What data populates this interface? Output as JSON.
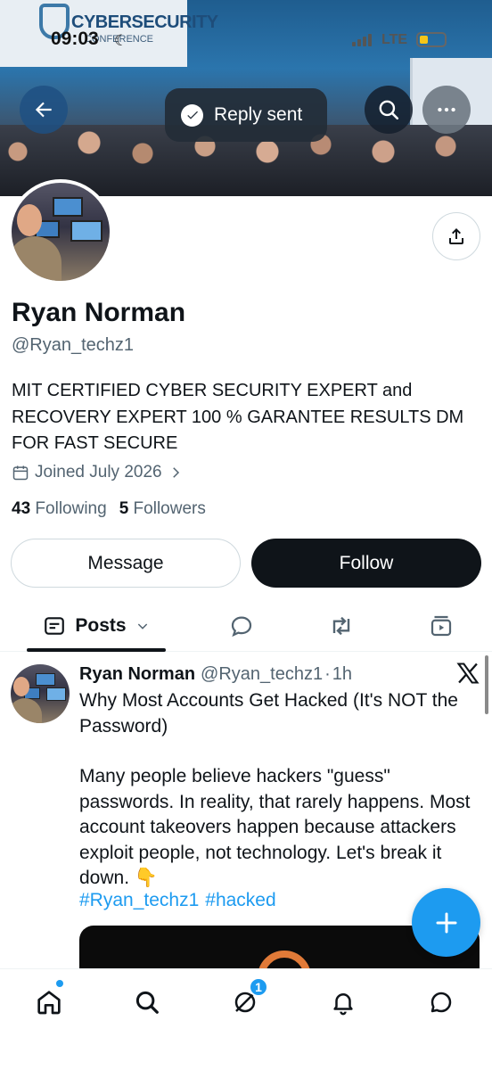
{
  "status_bar": {
    "time": "09:03",
    "network": "LTE"
  },
  "banner": {
    "screen_title": "CYBERSECURITY",
    "screen_subtitle": "CONFERENCE"
  },
  "toast": {
    "text": "Reply sent"
  },
  "profile": {
    "name": "Ryan Norman",
    "handle": "@Ryan_techz1",
    "bio": "MIT CERTIFIED CYBER SECURITY EXPERT and RECOVERY EXPERT 100 % GARANTEE RESULTS DM FOR FAST SECURE",
    "joined": "Joined July 2026",
    "following_count": "43",
    "following_label": "Following",
    "followers_count": "5",
    "followers_label": "Followers"
  },
  "actions": {
    "message_label": "Message",
    "follow_label": "Follow"
  },
  "tabs": {
    "posts_label": "Posts"
  },
  "post": {
    "author": "Ryan Norman",
    "handle": "@Ryan_techz1",
    "separator": "·",
    "time": "1h",
    "title": "Why Most Accounts Get Hacked (It's NOT the Password)",
    "body": "Many people believe hackers \"guess\" passwords. In reality, that rarely happens. Most account takeovers happen because attackers exploit people, not technology. Let's break it down. 👇",
    "hashtags": [
      "#Ryan_techz1",
      "#hacked"
    ]
  },
  "bottom_nav": {
    "notification_badge": "1"
  },
  "icons": {
    "back": "arrow-left-icon",
    "search": "search-icon",
    "more": "more-horizontal-icon",
    "share": "share-icon",
    "calendar": "calendar-icon",
    "chevron": "chevron-right-icon",
    "check": "check-circle-icon",
    "compose": "plus-icon"
  },
  "colors": {
    "accent": "#1d9bf0",
    "text": "#0f1419",
    "secondary": "#536471",
    "follow_bg": "#0f1419"
  }
}
